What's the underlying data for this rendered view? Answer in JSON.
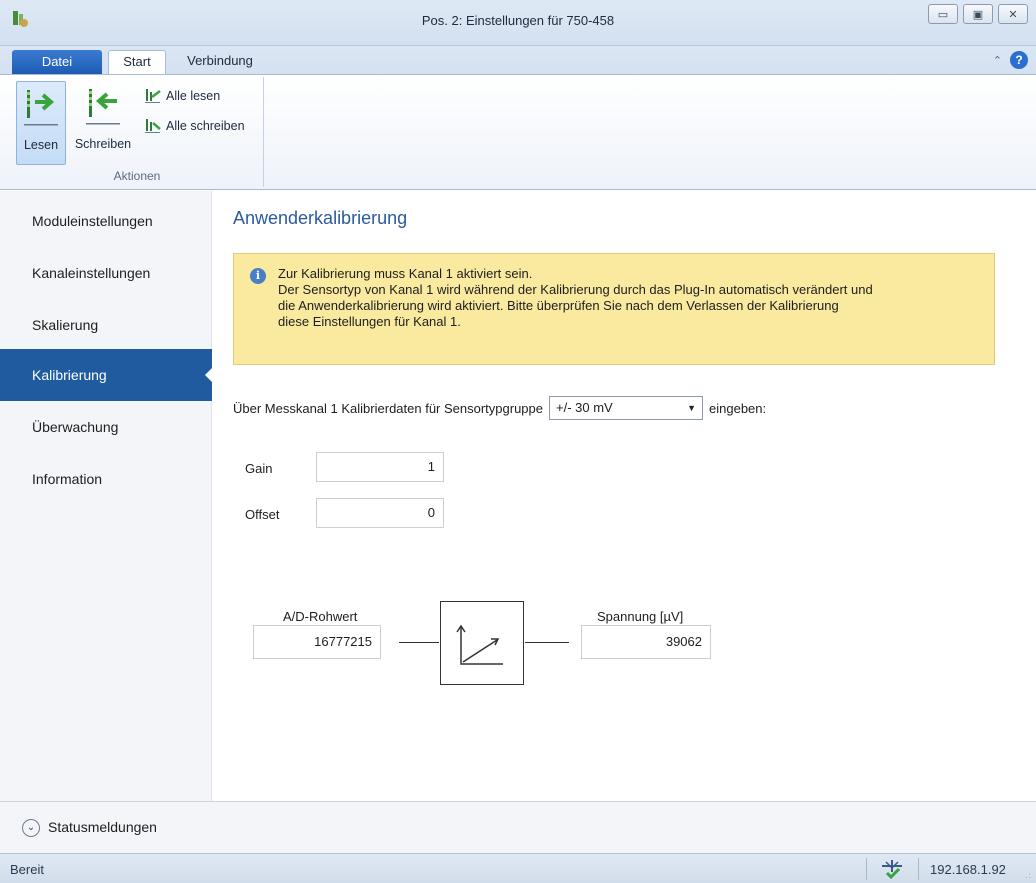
{
  "window": {
    "title": "Pos. 2: Einstellungen für 750-458",
    "minimize_label": "▭",
    "maximize_label": "▣",
    "close_label": "✕"
  },
  "ribbon": {
    "tabs": [
      {
        "label": "Datei"
      },
      {
        "label": "Start"
      },
      {
        "label": "Verbindung"
      }
    ],
    "help_label": "?",
    "collapse_label": "⌃",
    "group": {
      "label": "Aktionen",
      "lesen": "Lesen",
      "schreiben": "Schreiben",
      "alle_lesen": "Alle lesen",
      "alle_schreiben": "Alle schreiben"
    }
  },
  "sidebar": {
    "items": [
      {
        "label": "Moduleinstellungen"
      },
      {
        "label": "Kanaleinstellungen"
      },
      {
        "label": "Skalierung"
      },
      {
        "label": "Kalibrierung"
      },
      {
        "label": "Überwachung"
      },
      {
        "label": "Information"
      }
    ],
    "active_index": 3
  },
  "main": {
    "title": "Anwenderkalibrierung",
    "info": {
      "icon": "i",
      "lines": [
        "Zur Kalibrierung muss Kanal 1 aktiviert sein.",
        "Der Sensortyp von Kanal 1 wird während der Kalibrierung durch das Plug-In automatisch verändert und",
        "die Anwenderkalibrierung wird aktiviert. Bitte überprüfen Sie nach dem Verlassen der Kalibrierung",
        "diese Einstellungen für Kanal 1."
      ]
    },
    "sensor_prefix": "Über Messkanal 1 Kalibrierdaten für Sensortypgruppe",
    "sensor_selected": "+/- 30 mV",
    "sensor_suffix": "eingeben:",
    "gain_label": "Gain",
    "gain_value": "1",
    "offset_label": "Offset",
    "offset_value": "0",
    "raw_label": "A/D-Rohwert",
    "raw_value": "16777215",
    "volt_label": "Spannung [µV]",
    "volt_value": "39062"
  },
  "status_messages": {
    "label": "Statusmeldungen"
  },
  "statusbar": {
    "ready": "Bereit",
    "ip": "192.168.1.92"
  },
  "colors": {
    "accent": "#1f5b9e",
    "title_blue": "#2a5aa0",
    "info_bg": "#faeaa0"
  }
}
